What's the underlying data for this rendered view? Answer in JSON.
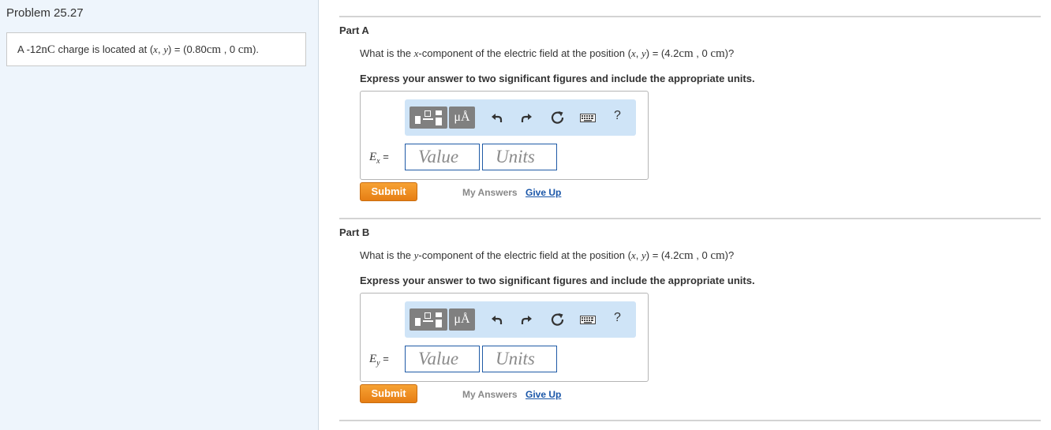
{
  "problem": {
    "title": "Problem 25.27",
    "statement_prefix": "A -12",
    "charge_units": "nC",
    "statement_mid": " charge is located at (",
    "x_var": "x",
    "comma": ", ",
    "y_var": "y",
    "eq_paren": ") = (0.80",
    "cm": "cm",
    "zero": " , 0 ",
    "cm2": "cm",
    "close": ")."
  },
  "parts": [
    {
      "title": "Part A",
      "question_prefix": "What is the ",
      "component_var": "x",
      "question_mid": "-component of the electric field at the position (",
      "x_var": "x",
      "comma": ", ",
      "y_var": "y",
      "eq_paren": ") = (4.2",
      "cm": "cm",
      "zero": " , 0 ",
      "cm2": "cm",
      "close": ")?",
      "instruction": "Express your answer to two significant figures and include the appropriate units.",
      "variable": "E",
      "variable_sub": "x",
      "equals": " =",
      "value_placeholder": "Value",
      "units_placeholder": "Units",
      "submit_label": "Submit",
      "my_answers_label": "My Answers",
      "give_up_label": "Give Up"
    },
    {
      "title": "Part B",
      "question_prefix": "What is the ",
      "component_var": "y",
      "question_mid": "-component of the electric field at the position (",
      "x_var": "x",
      "comma": ", ",
      "y_var": "y",
      "eq_paren": ") = (4.2",
      "cm": "cm",
      "zero": " , 0 ",
      "cm2": "cm",
      "close": ")?",
      "instruction": "Express your answer to two significant figures and include the appropriate units.",
      "variable": "E",
      "variable_sub": "y",
      "equals": " =",
      "value_placeholder": "Value",
      "units_placeholder": "Units",
      "submit_label": "Submit",
      "my_answers_label": "My Answers",
      "give_up_label": "Give Up"
    }
  ],
  "toolbar": {
    "units_button_label": "μÅ",
    "help_label": "?",
    "icons": [
      "templates-icon",
      "units-icon",
      "undo-icon",
      "redo-icon",
      "reset-icon",
      "keyboard-icon",
      "help-icon"
    ]
  },
  "colors": {
    "left_panel_bg": "#eef5fc",
    "toolbar_bg": "#cfe4f7",
    "submit_orange": "#f08a1f",
    "link_blue": "#1a56a8",
    "field_border": "#1f5aa6"
  }
}
